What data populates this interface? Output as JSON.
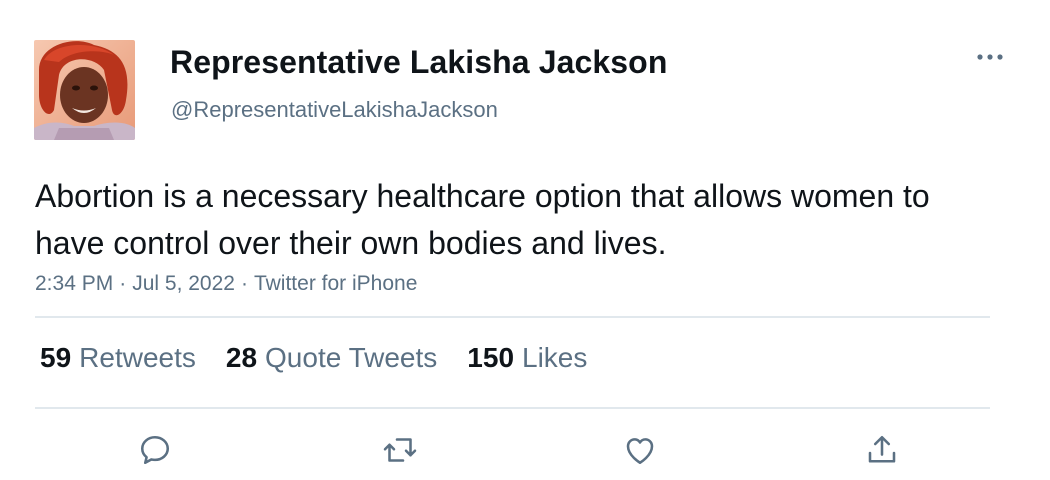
{
  "author": {
    "display_name": "Representative Lakisha Jackson",
    "handle": "@RepresentativeLakishaJackson"
  },
  "tweet": {
    "text": "Abortion is a necessary healthcare option that allows women to have control over their own bodies and lives.",
    "time": "2:34 PM",
    "separator": "·",
    "date": "Jul 5, 2022",
    "source": "Twitter for iPhone"
  },
  "stats": {
    "retweets_count": "59",
    "retweets_label": "Retweets",
    "quotes_count": "28",
    "quotes_label": "Quote Tweets",
    "likes_count": "150",
    "likes_label": "Likes"
  },
  "actions": {
    "reply_icon": "reply-icon",
    "retweet_icon": "retweet-icon",
    "like_icon": "heart-icon",
    "share_icon": "share-icon"
  },
  "colors": {
    "text_primary": "#0f1419",
    "text_secondary": "#5b7083",
    "divider": "#e1e8ed"
  }
}
